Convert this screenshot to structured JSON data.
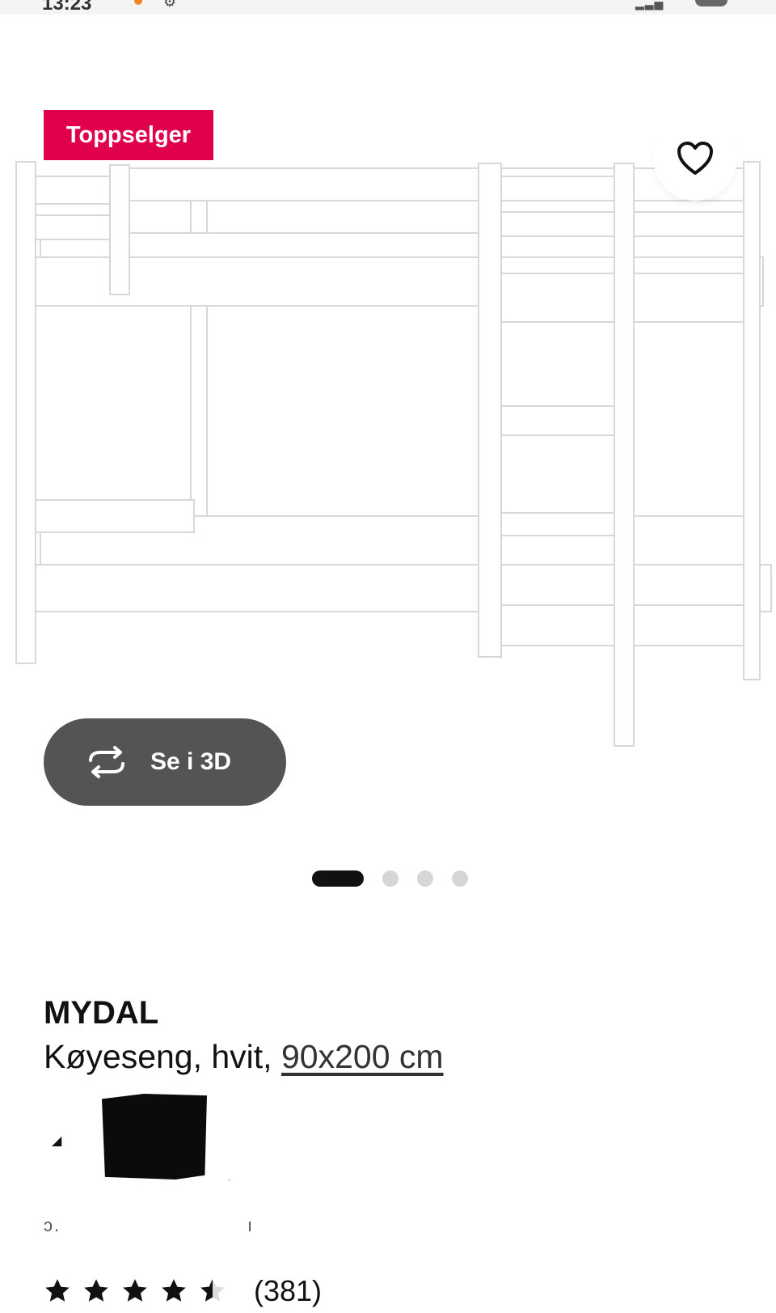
{
  "status_bar": {
    "time": "13:23",
    "icons": [
      "location-dot-icon",
      "gear-icon",
      "signal-icon",
      "battery-icon"
    ]
  },
  "product_image": {
    "badge": "Toppselger",
    "badge_color": "#e0004d",
    "favorite_icon": "heart-outline-icon",
    "view3d_label": "Se i 3D",
    "view3d_icon": "rotate-arrows-icon",
    "carousel": {
      "total": 4,
      "active_index": 0
    }
  },
  "product": {
    "name": "MYDAL",
    "description": "Køyeseng, hvit,",
    "size_link": "90x200 cm"
  },
  "rating": {
    "stars": 4.5,
    "max_stars": 5,
    "count": "(381)"
  }
}
